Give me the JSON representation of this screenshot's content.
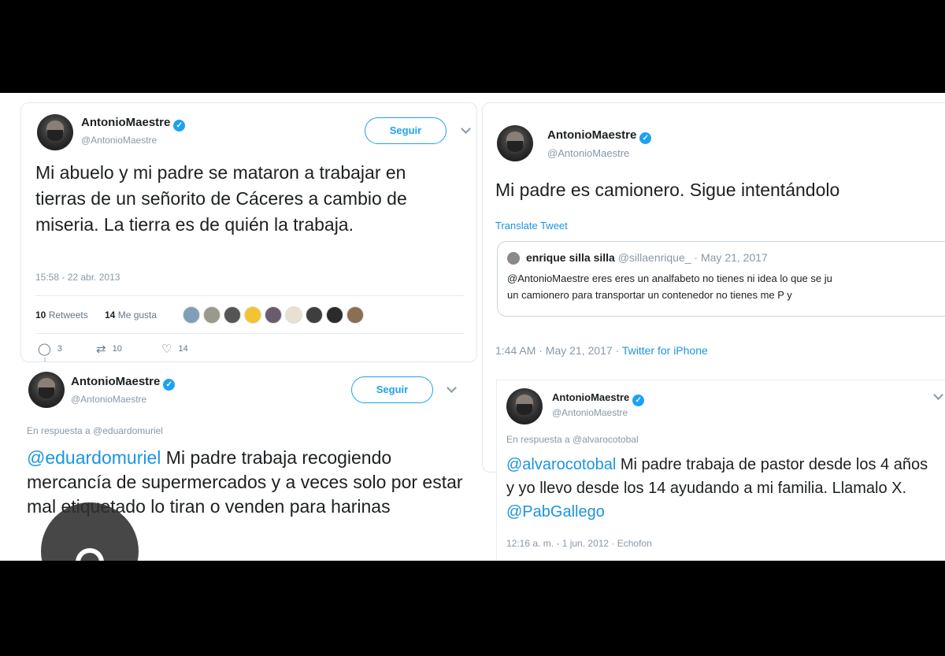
{
  "tweet1": {
    "name": "AntonioMaestre",
    "handle": "@AntonioMaestre",
    "follow_label": "Seguir",
    "text": "Mi abuelo y mi padre se mataron a trabajar en tierras de un señorito de Cáceres a cambio de miseria. La tierra es de quién la trabaja.",
    "timestamp": "15:58 - 22 abr. 2013",
    "retweets_count": "10",
    "retweets_label": "Retweets",
    "likes_count": "14",
    "likes_label": "Me gusta",
    "reply_count": "3",
    "retweet_action_count": "10",
    "like_action_count": "14"
  },
  "tweet2": {
    "name": "AntonioMaestre",
    "handle": "@AntonioMaestre",
    "follow_label": "Seguir",
    "reply_to": "En respuesta a @eduardomuriel",
    "mention": "@eduardomuriel",
    "text": " Mi padre trabaja recogiendo mercancía de supermercados y a veces solo por estar mal etiquetado lo tiran o venden para harinas"
  },
  "tweet3": {
    "name": "AntonioMaestre",
    "handle": "@AntonioMaestre",
    "text": "Mi padre es camionero. Sigue intentándolo",
    "translate_label": "Translate Tweet",
    "quoted": {
      "name": "enrique silla silla",
      "handle_date": "@sillaenrique_ · May 21, 2017",
      "line1": "@AntonioMaestre eres eres un analfabeto no tienes ni idea lo que se ju",
      "line2": "un camionero para transportar un contenedor no tienes me P y"
    },
    "timestamp": "1:44 AM · May 21, 2017 · ",
    "source": "Twitter for iPhone"
  },
  "tweet4": {
    "name": "AntonioMaestre",
    "handle": "@AntonioMaestre",
    "reply_to": "En respuesta a @alvarocotobal",
    "mention": "@alvarocotobal",
    "text": " Mi padre trabaja de pastor desde los 4 años y yo llevo desde los 14 ayudando a mi familia. Llamalo X. ",
    "mention2": "@PabGallego",
    "timestamp": "12:16 a. m. - 1 jun. 2012 · ",
    "source": "Echofon"
  },
  "colors": {
    "link": "#1b95e0",
    "verified": "#1da1f2",
    "meta": "#8899a6"
  },
  "icons": [
    "verified-icon",
    "reply-icon",
    "retweet-icon",
    "heart-icon",
    "chevron-down-icon",
    "lock-icon"
  ]
}
